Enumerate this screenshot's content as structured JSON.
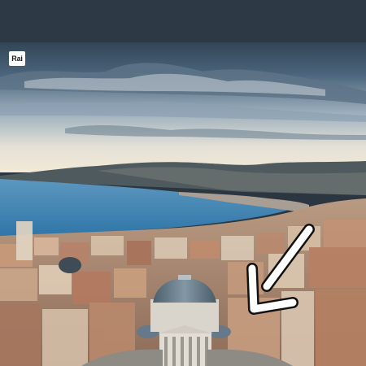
{
  "logo": {
    "text": "Rai"
  },
  "icons": {
    "pointer": "arrow-down-left-icon"
  },
  "colors": {
    "sky_top": "#3b5064",
    "sky_low": "#f2e7d2",
    "sea": "#3f86b5",
    "roofs": "#c9906a",
    "dome": "#6c7e8c",
    "arrow_fill": "#ffffff",
    "arrow_stroke": "#111111"
  }
}
